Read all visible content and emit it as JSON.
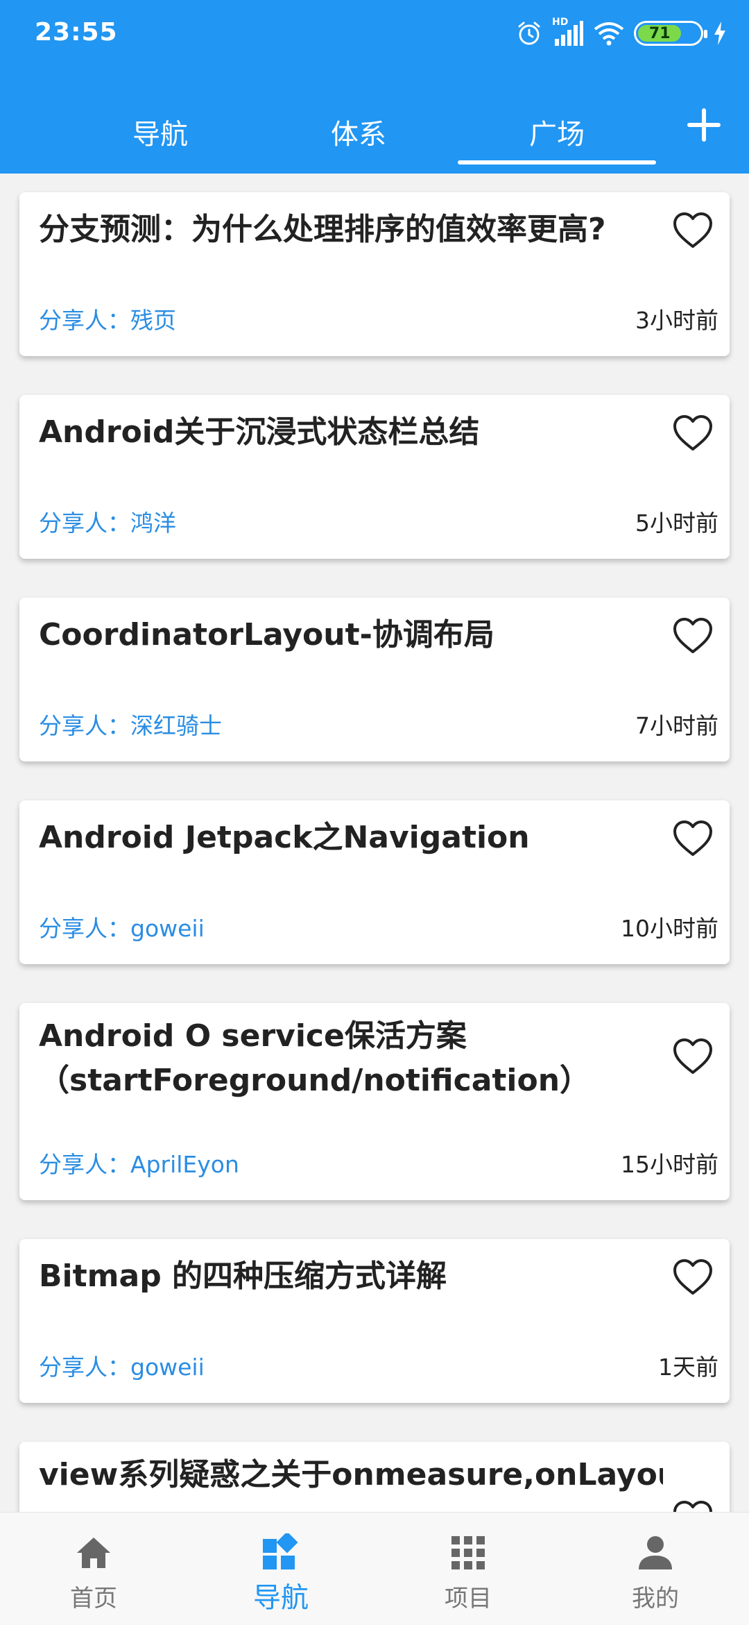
{
  "status_bar": {
    "time": "23:55",
    "network": "HD",
    "battery": "71",
    "icons": [
      "alarm-icon",
      "signal-icon",
      "wifi-icon",
      "battery-icon",
      "charging-icon"
    ]
  },
  "tabs": [
    {
      "label": "导航",
      "active": false
    },
    {
      "label": "体系",
      "active": false
    },
    {
      "label": "广场",
      "active": true
    }
  ],
  "add_icon": "plus-icon",
  "colors": {
    "primary": "#2196F3",
    "sharer": "#2a8de3"
  },
  "articles": [
    {
      "title": "分支预测：为什么处理排序的值效率更高?",
      "sharer_label": "分享人：",
      "author": "残页",
      "time": "3小时前"
    },
    {
      "title": "Android关于沉浸式状态栏总结",
      "sharer_label": "分享人：",
      "author": "鸿洋",
      "time": "5小时前"
    },
    {
      "title": "CoordinatorLayout-协调布局",
      "sharer_label": "分享人：",
      "author": "深红骑士",
      "time": "7小时前"
    },
    {
      "title": "Android Jetpack之Navigation",
      "sharer_label": "分享人：",
      "author": "goweii",
      "time": "10小时前"
    },
    {
      "title": "Android O service保活方案（startForeground/notification）",
      "sharer_label": "分享人：",
      "author": "AprilEyon",
      "time": "15小时前"
    },
    {
      "title": "Bitmap 的四种压缩方式详解",
      "sharer_label": "分享人：",
      "author": "goweii",
      "time": "1天前"
    },
    {
      "title": "view系列疑惑之关于onmeasure,onLayout,",
      "sharer_label": "",
      "author": "",
      "time": ""
    }
  ],
  "bottom_nav": [
    {
      "label": "首页",
      "icon": "home-icon",
      "active": false
    },
    {
      "label": "导航",
      "icon": "navigation-icon",
      "active": true
    },
    {
      "label": "项目",
      "icon": "grid-icon",
      "active": false
    },
    {
      "label": "我的",
      "icon": "person-icon",
      "active": false
    }
  ]
}
